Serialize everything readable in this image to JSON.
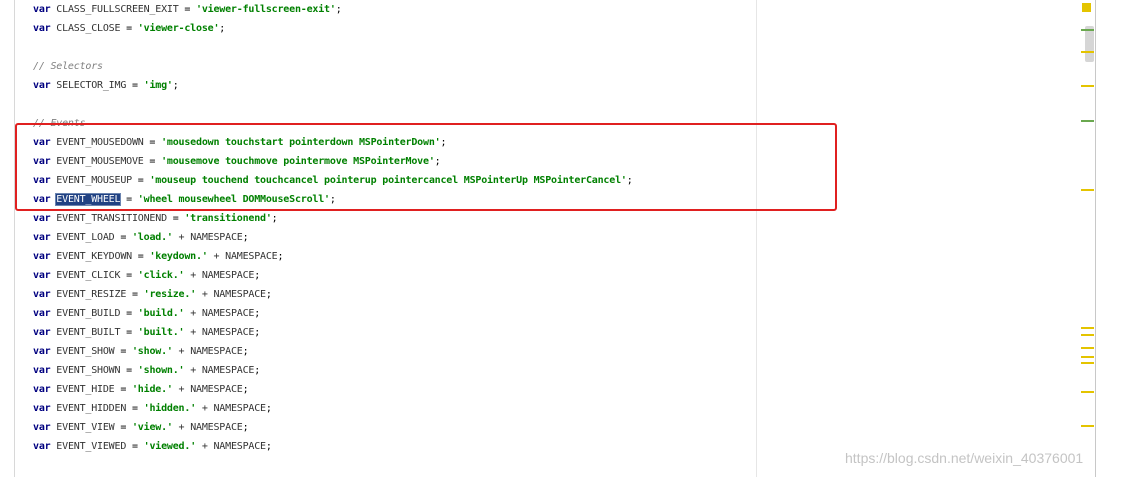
{
  "code_lines": [
    {
      "kw": "var",
      "name": "CLASS_FULLSCREEN_EXIT",
      "eq": " = ",
      "value": "'viewer-fullscreen-exit'",
      "end": ";"
    },
    {
      "kw": "var",
      "name": "CLASS_CLOSE",
      "eq": " = ",
      "value": "'viewer-close'",
      "end": ";"
    },
    {
      "comment": ""
    },
    {
      "comment": "// Selectors"
    },
    {
      "kw": "var",
      "name": "SELECTOR_IMG",
      "eq": " = ",
      "value": "'img'",
      "end": ";"
    },
    {
      "comment": ""
    },
    {
      "comment": "// Events"
    },
    {
      "kw": "var",
      "name": "EVENT_MOUSEDOWN",
      "eq": " = ",
      "value": "'mousedown touchstart pointerdown MSPointerDown'",
      "end": ";"
    },
    {
      "kw": "var",
      "name": "EVENT_MOUSEMOVE",
      "eq": " = ",
      "value": "'mousemove touchmove pointermove MSPointerMove'",
      "end": ";"
    },
    {
      "kw": "var",
      "name": "EVENT_MOUSEUP",
      "eq": " = ",
      "value": "'mouseup touchend touchcancel pointerup pointercancel MSPointerUp MSPointerCancel'",
      "end": ";"
    },
    {
      "kw": "var",
      "name": "EVENT_WHEEL",
      "eq": " = ",
      "value": "'wheel mousewheel DOMMouseScroll'",
      "end": ";",
      "selected": true,
      "current": true
    },
    {
      "kw": "var",
      "name": "EVENT_TRANSITIONEND",
      "eq": " = ",
      "value": "'transitionend'",
      "end": ";"
    },
    {
      "kw": "var",
      "name": "EVENT_LOAD",
      "eq": " = ",
      "value": "'load.'",
      "concat": " + NAMESPACE",
      "end": ";"
    },
    {
      "kw": "var",
      "name": "EVENT_KEYDOWN",
      "eq": " = ",
      "value": "'keydown.'",
      "concat": " + NAMESPACE",
      "end": ";"
    },
    {
      "kw": "var",
      "name": "EVENT_CLICK",
      "eq": " = ",
      "value": "'click.'",
      "concat": " + NAMESPACE",
      "end": ";"
    },
    {
      "kw": "var",
      "name": "EVENT_RESIZE",
      "eq": " = ",
      "value": "'resize.'",
      "concat": " + NAMESPACE",
      "end": ";"
    },
    {
      "kw": "var",
      "name": "EVENT_BUILD",
      "eq": " = ",
      "value": "'build.'",
      "concat": " + NAMESPACE",
      "end": ";"
    },
    {
      "kw": "var",
      "name": "EVENT_BUILT",
      "eq": " = ",
      "value": "'built.'",
      "concat": " + NAMESPACE",
      "end": ";"
    },
    {
      "kw": "var",
      "name": "EVENT_SHOW",
      "eq": " = ",
      "value": "'show.'",
      "concat": " + NAMESPACE",
      "end": ";"
    },
    {
      "kw": "var",
      "name": "EVENT_SHOWN",
      "eq": " = ",
      "value": "'shown.'",
      "concat": " + NAMESPACE",
      "end": ";"
    },
    {
      "kw": "var",
      "name": "EVENT_HIDE",
      "eq": " = ",
      "value": "'hide.'",
      "concat": " + NAMESPACE",
      "end": ";"
    },
    {
      "kw": "var",
      "name": "EVENT_HIDDEN",
      "eq": " = ",
      "value": "'hidden.'",
      "concat": " + NAMESPACE",
      "end": ";"
    },
    {
      "kw": "var",
      "name": "EVENT_VIEW",
      "eq": " = ",
      "value": "'view.'",
      "concat": " + NAMESPACE",
      "end": ";"
    },
    {
      "kw": "var",
      "name": "EVENT_VIEWED",
      "eq": " = ",
      "value": "'viewed.'",
      "concat": " + NAMESPACE",
      "end": ";"
    }
  ],
  "watermark": "https://blog.csdn.net/weixin_40376001",
  "colors": {
    "keyword": "#000080",
    "string": "#008000",
    "comment": "#808080",
    "selection": "#214283",
    "highlight_box": "#e02020",
    "current_line": "#fffae3"
  }
}
